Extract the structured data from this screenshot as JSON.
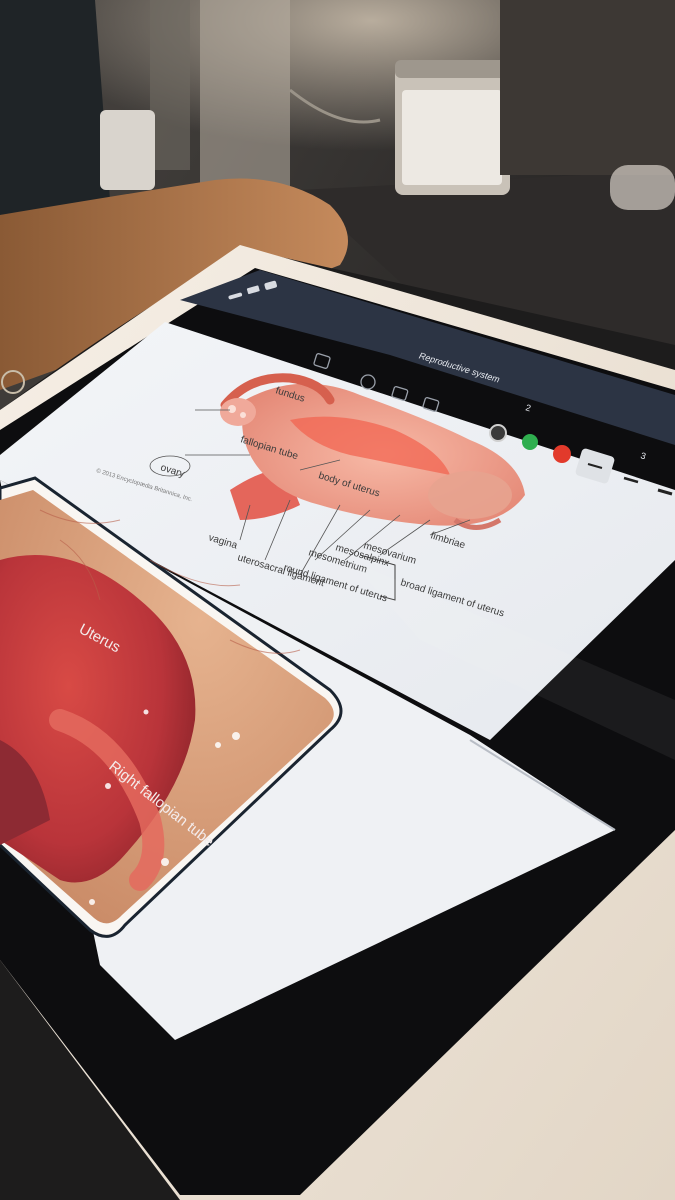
{
  "app": {
    "document_title": "Reproductive system",
    "page_indicator": "2",
    "page_indicator_2": "3"
  },
  "toolbar": {
    "colors": [
      "#3a3a3a",
      "#2fae4f",
      "#e23a2b"
    ],
    "tool_icons": [
      "pen-icon",
      "highlighter-icon",
      "eraser-icon",
      "lasso-icon",
      "shapes-icon",
      "image-icon",
      "text-icon"
    ],
    "stroke_sizes": [
      "thin",
      "medium",
      "thick"
    ]
  },
  "diagram": {
    "labels": {
      "ovary": "ovary",
      "fundus": "fundus",
      "fallopian_tube": "fallopian tube",
      "body_of_uterus": "body of uterus",
      "vagina": "vagina",
      "uterosacral_ligament": "uterosacral ligament",
      "round_ligament": "round ligament of uterus",
      "mesometrium": "mesometrium",
      "mesosalpinx": "mesosalpinx",
      "mesovarium": "mesovarium",
      "broad_ligament": "broad ligament of uterus",
      "fimbriae": "fimbriae",
      "copyright": "© 2013 Encyclopædia Britannica, Inc."
    }
  },
  "photo": {
    "labels": {
      "uterus": "Uterus",
      "right_fallopian_tube": "Right fallopian tube"
    }
  }
}
